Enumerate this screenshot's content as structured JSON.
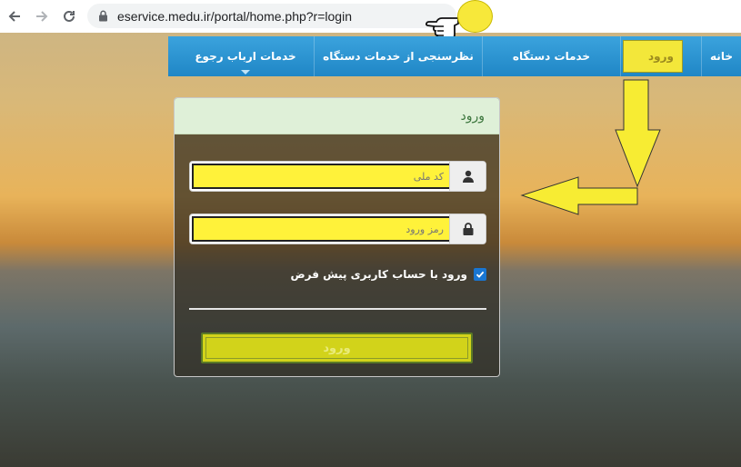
{
  "browser": {
    "url": "eservice.medu.ir/portal/home.php?r=login"
  },
  "menu": {
    "items": [
      {
        "label": "خانه"
      },
      {
        "label": "ورود"
      },
      {
        "label": "خدمات دستگاه"
      },
      {
        "label": "نظرسنجی از خدمات دستگاه"
      },
      {
        "label": "خدمات ارباب رجوع"
      }
    ]
  },
  "login": {
    "title": "ورود",
    "username_placeholder": "کد ملی",
    "password_placeholder": "رمز ورود",
    "remember_label": "ورود با حساب کاربری پیش فرض",
    "remember_checked": true,
    "submit_label": "ورود"
  },
  "colors": {
    "menu_blue": "#1f86c6",
    "highlight_yellow": "#f3e73a",
    "panel_header_green": "#dff0d8",
    "checkbox_blue": "#1976d2"
  },
  "icons": [
    "back-arrow-icon",
    "forward-arrow-icon",
    "reload-icon",
    "lock-icon",
    "hand-pointer-icon",
    "user-icon",
    "padlock-icon",
    "check-icon"
  ]
}
